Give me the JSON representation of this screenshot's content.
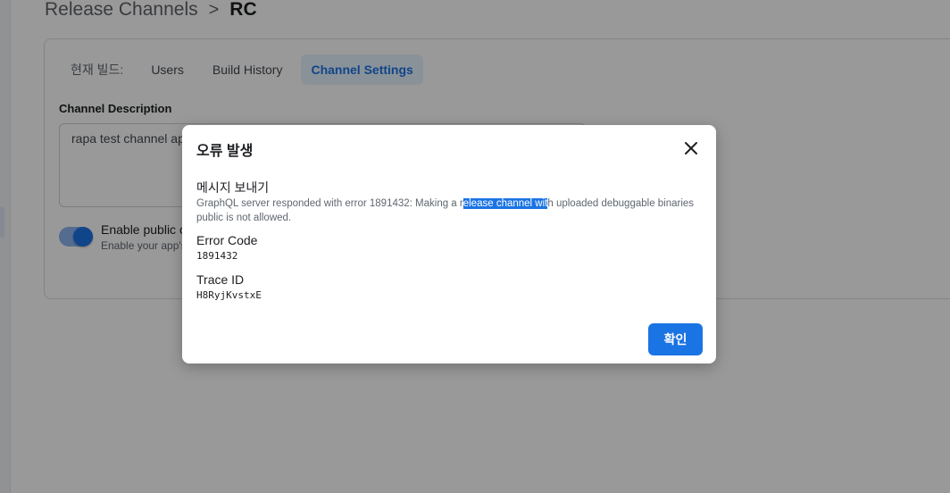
{
  "page": {
    "breadcrumb": {
      "parent": "Release Channels",
      "separator": ">",
      "current": "RC"
    },
    "tabs": {
      "lead_label": "현재 빌드:",
      "items": [
        {
          "label": "Users",
          "active": false
        },
        {
          "label": "Build History",
          "active": false
        },
        {
          "label": "Channel Settings",
          "active": true
        }
      ]
    },
    "channel_description": {
      "label": "Channel Description",
      "value": "rapa test channel ap"
    },
    "public_toggle": {
      "title": "Enable public c",
      "subtitle": "Enable your app's",
      "enabled": true
    }
  },
  "dialog": {
    "title": "오류 발생",
    "close_icon": "close-icon",
    "message_label": "메시지 보내기",
    "message": {
      "before": "GraphQL server responded with error 1891432: Making a r",
      "highlighted": "elease channel wit",
      "after": "h uploaded debuggable binaries public is not allowed."
    },
    "error_code_label": "Error Code",
    "error_code": "1891432",
    "trace_id_label": "Trace ID",
    "trace_id": "H8RyjKvstxE",
    "confirm_label": "확인"
  },
  "colors": {
    "accent": "#1b74e4",
    "overlay": "rgba(0,0,0,0.4)"
  }
}
